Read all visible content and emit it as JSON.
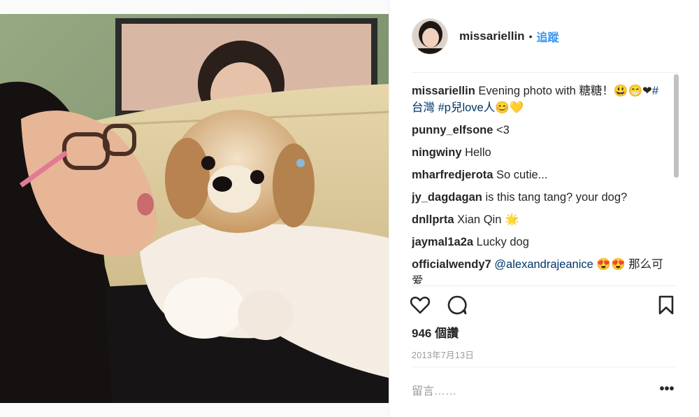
{
  "post": {
    "username": "missariellin",
    "dot": "•",
    "follow_label": "追蹤",
    "comments": [
      {
        "user": "missariellin",
        "parts": [
          {
            "text": " Evening photo with 糖糖！😃"
          },
          {
            "text": "😁❤"
          },
          {
            "text": "#台灣",
            "tag": true
          },
          {
            "text": " "
          },
          {
            "text": "#p兒love人",
            "tag": true
          },
          {
            "text": "😊💛"
          }
        ]
      },
      {
        "user": "punny_elfsone",
        "parts": [
          {
            "text": " <3"
          }
        ]
      },
      {
        "user": "ningwiny",
        "parts": [
          {
            "text": " Hello"
          }
        ]
      },
      {
        "user": "mharfredjerota",
        "parts": [
          {
            "text": " So cutie..."
          }
        ]
      },
      {
        "user": "jy_dagdagan",
        "parts": [
          {
            "text": " is this tang tang? your dog?"
          }
        ]
      },
      {
        "user": "dnllprta",
        "parts": [
          {
            "text": " Xian Qin 🌟"
          }
        ]
      },
      {
        "user": "jaymal1a2a",
        "parts": [
          {
            "text": " Lucky dog"
          }
        ]
      },
      {
        "user": "officialwendy7",
        "parts": [
          {
            "text": " "
          },
          {
            "text": "@alexandrajeanice",
            "tag": true
          },
          {
            "text": " 😍😍 那么可爱"
          }
        ]
      }
    ],
    "likes": "946 個讚",
    "date": "2013年7月13日",
    "comment_placeholder": "留言……",
    "more_label": "•••",
    "icons": {
      "like": "heart-outline-icon",
      "comment": "speech-bubble-icon",
      "save": "bookmark-icon",
      "more": "ellipsis-icon"
    },
    "colors": {
      "link": "#003569",
      "follow": "#3897f0",
      "meta": "#999999"
    }
  }
}
